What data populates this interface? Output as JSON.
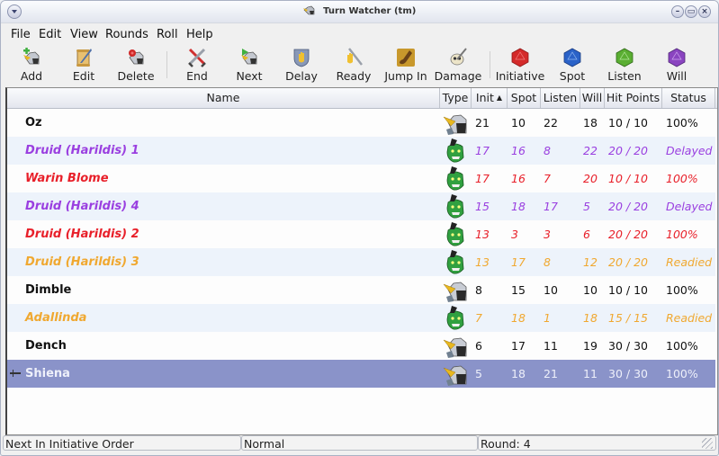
{
  "window": {
    "title": "Turn Watcher (tm)",
    "buttons": [
      "minimize",
      "maximize",
      "close"
    ]
  },
  "menubar": [
    "File",
    "Edit",
    "View",
    "Rounds",
    "Roll",
    "Help"
  ],
  "toolbar": [
    {
      "label": "Add",
      "icon": "add-combatant-icon"
    },
    {
      "label": "Edit",
      "icon": "scroll-quill-icon"
    },
    {
      "label": "Delete",
      "icon": "delete-combatant-icon"
    },
    {
      "label": "End",
      "icon": "crossed-swords-icon"
    },
    {
      "label": "Next",
      "icon": "next-combatant-icon"
    },
    {
      "label": "Delay",
      "icon": "hand-shield-icon"
    },
    {
      "label": "Ready",
      "icon": "hand-sword-icon"
    },
    {
      "label": "Jump In",
      "icon": "boot-icon"
    },
    {
      "label": "Damage",
      "icon": "skull-sword-icon"
    },
    {
      "label": "Initiative",
      "icon": "red-die-icon",
      "color": "#d42a2a"
    },
    {
      "label": "Spot",
      "icon": "blue-die-icon",
      "color": "#2a62c8"
    },
    {
      "label": "Listen",
      "icon": "green-die-icon",
      "color": "#5aae32"
    },
    {
      "label": "Will",
      "icon": "purple-die-icon",
      "color": "#8a44c0"
    }
  ],
  "table": {
    "columns": [
      "Name",
      "Type",
      "Init",
      "Spot",
      "Listen",
      "Will",
      "Hit Points",
      "Status"
    ],
    "sort_column": "Init",
    "sort_direction": "ascending-indicator",
    "rows": [
      {
        "name": "Oz",
        "type": "player",
        "init": "21",
        "spot": "10",
        "listen": "22",
        "will": "18",
        "hp": "10 / 10",
        "status": "100%",
        "color": "#111111",
        "italic": false
      },
      {
        "name": "Druid (Harildis) 1",
        "type": "monster",
        "init": "17",
        "spot": "16",
        "listen": "8",
        "will": "22",
        "hp": "20 / 20",
        "status": "Delayed",
        "color": "#9a3fe0",
        "italic": true
      },
      {
        "name": "Warin Blome",
        "type": "monster",
        "init": "17",
        "spot": "16",
        "listen": "7",
        "will": "20",
        "hp": "10 / 10",
        "status": "100%",
        "color": "#e8202a",
        "italic": true
      },
      {
        "name": "Druid (Harildis) 4",
        "type": "monster",
        "init": "15",
        "spot": "18",
        "listen": "17",
        "will": "5",
        "hp": "20 / 20",
        "status": "Delayed",
        "color": "#9a3fe0",
        "italic": true
      },
      {
        "name": "Druid (Harildis) 2",
        "type": "monster",
        "init": "13",
        "spot": "3",
        "listen": "3",
        "will": "6",
        "hp": "20 / 20",
        "status": "100%",
        "color": "#e8202a",
        "italic": true
      },
      {
        "name": "Druid (Harildis) 3",
        "type": "monster",
        "init": "13",
        "spot": "17",
        "listen": "8",
        "will": "12",
        "hp": "20 / 20",
        "status": "Readied",
        "color": "#f0a830",
        "italic": true
      },
      {
        "name": "Dimble",
        "type": "player",
        "init": "8",
        "spot": "15",
        "listen": "10",
        "will": "10",
        "hp": "10 / 10",
        "status": "100%",
        "color": "#111111",
        "italic": false
      },
      {
        "name": "Adallinda",
        "type": "monster",
        "init": "7",
        "spot": "18",
        "listen": "1",
        "will": "18",
        "hp": "15 / 15",
        "status": "Readied",
        "color": "#f0a830",
        "italic": true
      },
      {
        "name": "Dench",
        "type": "player",
        "init": "6",
        "spot": "17",
        "listen": "11",
        "will": "19",
        "hp": "30 / 30",
        "status": "100%",
        "color": "#111111",
        "italic": false
      },
      {
        "name": "Shiena",
        "type": "player",
        "init": "5",
        "spot": "18",
        "listen": "21",
        "will": "11",
        "hp": "30 / 30",
        "status": "100%",
        "color": "#eef0fa",
        "italic": false,
        "selected": true,
        "current_turn": true
      }
    ]
  },
  "statusbar": {
    "action": "Next In Initiative Order",
    "mode": "Normal",
    "round": "Round: 4"
  },
  "colors": {
    "selection": "#8a93c9",
    "alt_row": "#edf3fb",
    "delayed": "#9a3fe0",
    "readied": "#f0a830",
    "enemy": "#e8202a"
  }
}
